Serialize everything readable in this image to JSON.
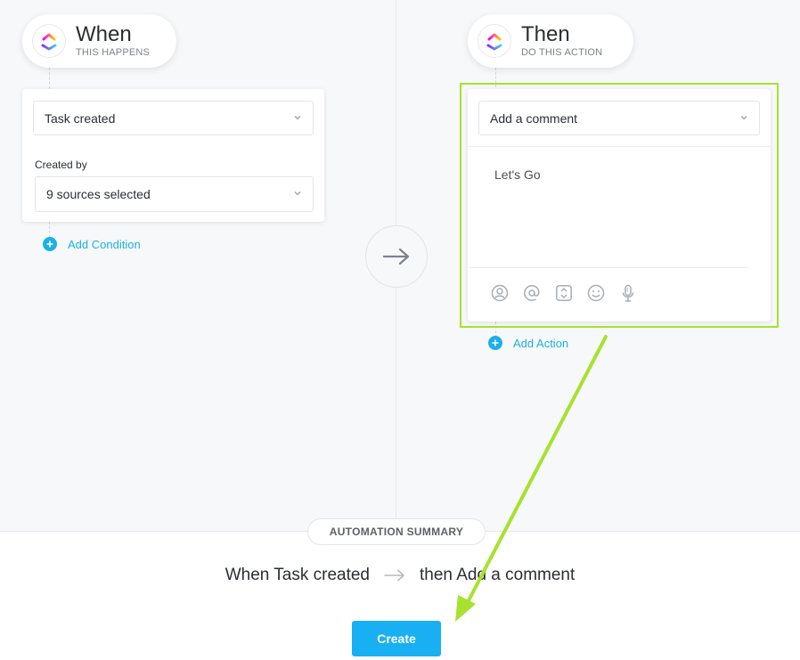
{
  "trigger": {
    "title": "When",
    "subtitle": "THIS HAPPENS",
    "event_select": "Task created",
    "created_by_label": "Created by",
    "sources_select": "9 sources selected",
    "add_condition": "Add Condition"
  },
  "action": {
    "title": "Then",
    "subtitle": "DO THIS ACTION",
    "action_select": "Add a comment",
    "comment_text": "Let's Go",
    "add_action": "Add Action",
    "toolbar_icons": [
      "assign-icon",
      "mention-icon",
      "attachment-icon",
      "emoji-icon",
      "microphone-icon"
    ]
  },
  "summary": {
    "label": "AUTOMATION SUMMARY",
    "when_text": "When Task created",
    "then_text": "then Add a comment"
  },
  "create_label": "Create",
  "colors": {
    "accent_blue": "#18b0f2",
    "highlight_green": "#a6e22e"
  }
}
